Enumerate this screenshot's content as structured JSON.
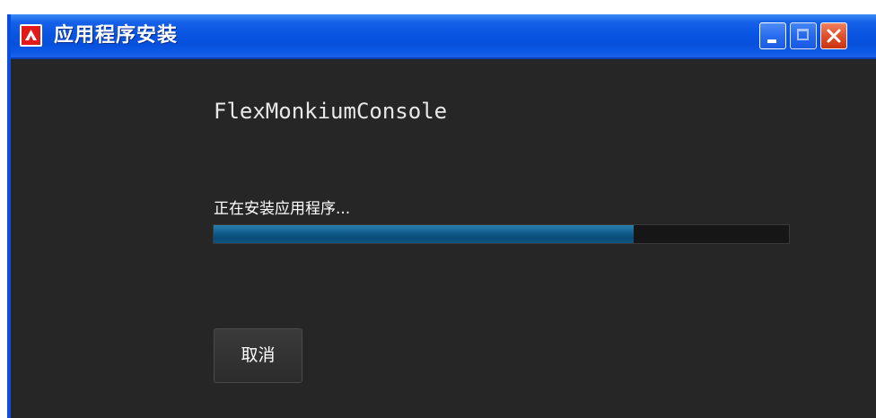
{
  "window": {
    "title": "应用程序安装",
    "icon": "adobe-air-icon",
    "controls": {
      "minimize_icon": "minimize-icon",
      "maximize_icon": "maximize-icon",
      "close_icon": "close-icon"
    }
  },
  "content": {
    "app_name": "FlexMonkiumConsole",
    "status": "正在安装应用程序...",
    "progress": 0.73,
    "cancel_label": "取消"
  },
  "colors": {
    "titlebar": "#0a55e2",
    "background": "#262626",
    "progress_fill": "#115c8c",
    "close_button": "#e2502a"
  }
}
